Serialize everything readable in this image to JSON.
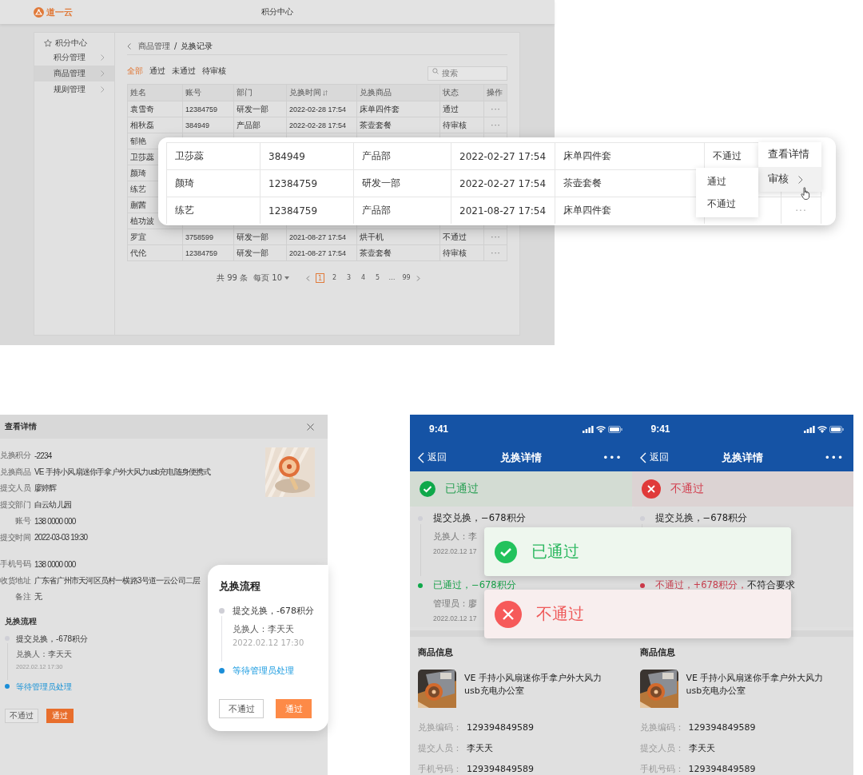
{
  "admin": {
    "logo": "道一云",
    "title": "积分中心",
    "sidebar": {
      "title": "积分中心",
      "items": [
        {
          "label": "积分管理",
          "selected": false
        },
        {
          "label": "商品管理",
          "selected": true
        },
        {
          "label": "规则管理",
          "selected": false
        }
      ]
    },
    "breadcrumb": {
      "parent": "商品管理",
      "separator": "/",
      "current": "兑换记录"
    },
    "filters": [
      {
        "label": "全部",
        "selected": true
      },
      {
        "label": "通过",
        "selected": false
      },
      {
        "label": "未通过",
        "selected": false
      },
      {
        "label": "待审核",
        "selected": false
      }
    ],
    "search": {
      "placeholder": "搜索"
    },
    "table": {
      "columns": [
        {
          "label": "姓名",
          "sortable": false
        },
        {
          "label": "账号",
          "sortable": false
        },
        {
          "label": "部门",
          "sortable": false
        },
        {
          "label": "兑换时间",
          "sortable": true
        },
        {
          "label": "兑换商品",
          "sortable": false
        },
        {
          "label": "状态",
          "sortable": false
        },
        {
          "label": "操作",
          "sortable": false
        }
      ],
      "rows": [
        {
          "cells": [
            "袁雪奇",
            "12384759",
            "研发一部",
            "2022-02-28 17:54",
            "床单四件套",
            "通过"
          ],
          "action": "···"
        },
        {
          "cells": [
            "相秋磊",
            "384949",
            "产品部",
            "2022-02-28 17:54",
            "茶壶套餐",
            "待审核"
          ],
          "action": "···"
        },
        {
          "cells": [
            "郁艳"
          ]
        },
        {
          "cells": [
            "卫莎蕊"
          ]
        },
        {
          "cells": [
            "颜琦"
          ]
        },
        {
          "cells": [
            "练艺"
          ]
        },
        {
          "cells": [
            "蒯茜"
          ]
        },
        {
          "cells": [
            "植功波"
          ]
        },
        {
          "cells": [
            "罗宜",
            "3758599",
            "研发一部",
            "2021-08-27 17:54",
            "烘干机",
            "不通过"
          ],
          "action": "···"
        },
        {
          "cells": [
            "代伦",
            "12384759",
            "研发一部",
            "2021-08-27 17:54",
            "茶壶套餐",
            "待审核"
          ],
          "action": "···"
        }
      ]
    },
    "pagination": {
      "total": "共 99 条",
      "page_size": "每页 10",
      "pages": [
        {
          "label": "1",
          "selected": true
        },
        {
          "label": "2",
          "selected": false
        },
        {
          "label": "3",
          "selected": false
        },
        {
          "label": "4",
          "selected": false
        },
        {
          "label": "5",
          "selected": false
        },
        {
          "label": "…",
          "selected": false
        },
        {
          "label": "99",
          "selected": false
        }
      ]
    }
  },
  "row_menu_zoom": {
    "rows": [
      {
        "cells": [
          "卫莎蕊",
          "384949",
          "产品部",
          "2022-02-27 17:54",
          "床单四件套",
          "不通过"
        ]
      },
      {
        "cells": [
          "颜琦",
          "12384759",
          "研发一部",
          "2022-02-27 17:54",
          "茶壶套餐"
        ]
      },
      {
        "cells": [
          "练艺",
          "12384759",
          "产品部",
          "2021-08-27 17:54",
          "床单四件套"
        ],
        "action": "···"
      }
    ],
    "menu": [
      {
        "label": "查看详情",
        "selected": false,
        "has_submenu": false
      },
      {
        "label": "审核",
        "selected": true,
        "has_submenu": true
      }
    ],
    "submenu": [
      {
        "label": "通过"
      },
      {
        "label": "不通过"
      }
    ]
  },
  "detail_dialog": {
    "title": "查看详情",
    "field_groups": [
      [
        {
          "label": "兑换积分",
          "value": "-2234"
        },
        {
          "label": "兑换商品",
          "value": "VE 手持小风扇迷你手拿户外大风力usb充电随身便携式"
        },
        {
          "label": "提交人员",
          "value": "廖婷辉"
        },
        {
          "label": "提交部门",
          "value": "白云幼儿园"
        },
        {
          "label": "账号",
          "value": "138 0000 000"
        },
        {
          "label": "提交时间",
          "value": "2022-03-03 19:30"
        }
      ],
      [
        {
          "label": "手机号码",
          "value": "138 0000 000"
        },
        {
          "label": "收货地址",
          "value": "广东省广州市天河区员村一横路3号道一云公司二层"
        },
        {
          "label": "备注",
          "value": "无"
        }
      ]
    ],
    "flow_title": "兑换流程",
    "steps": [
      {
        "kind": "done",
        "title": "提交兑换，-678积分",
        "person": "兑换人：李天天",
        "time": "2022.02.12 17:30"
      },
      {
        "kind": "pending",
        "title": "等待管理员处理"
      }
    ],
    "reject_button": "不通过",
    "approve_button": "通过"
  },
  "flow_card": {
    "title": "兑换流程",
    "steps": [
      {
        "kind": "done",
        "title": "提交兑换，-678积分",
        "person": "兑换人：李天天",
        "time": "2022.02.12 17:30"
      },
      {
        "kind": "pending",
        "title": "等待管理员处理"
      }
    ],
    "reject_button": "不通过",
    "approve_button": "通过"
  },
  "phones": [
    {
      "time": "9:41",
      "back": "返回",
      "title": "兑换详情",
      "more": "•••",
      "status": {
        "kind": "approved",
        "label": "已通过"
      },
      "steps": [
        {
          "kind": "done",
          "title": "提交兑换，−678积分",
          "person": "兑换人：李",
          "time": "2022.02.12 17"
        },
        {
          "kind": "approved",
          "title": "已通过，−678积分",
          "person": "管理员：廖",
          "time": "2022.02.12 17"
        }
      ],
      "product_section": "商品信息",
      "product_name": "VE 手持小风扇迷你手拿户外大风力usb充电办公室",
      "fields": [
        {
          "label": "兑换编码：",
          "value": "129394849589"
        },
        {
          "label": "提交人员：",
          "value": "李天天"
        },
        {
          "label": "手机号码：",
          "value": "129394849589"
        }
      ]
    },
    {
      "time": "9:41",
      "back": "返回",
      "title": "兑换详情",
      "more": "•••",
      "status": {
        "kind": "rejected",
        "label": "不通过"
      },
      "steps": [
        {
          "kind": "done",
          "title": "提交兑换，−678积分"
        },
        {
          "kind": "rejected",
          "title": "不通过，+678积分，",
          "note": "不符合要求"
        }
      ],
      "product_section": "商品信息",
      "product_name": "VE 手持小风扇迷你手拿户外大风力usb充电办公室",
      "fields": [
        {
          "label": "兑换编码：",
          "value": "129394849589"
        },
        {
          "label": "提交人员：",
          "value": "李天天"
        },
        {
          "label": "手机号码：",
          "value": "129394849589"
        }
      ]
    }
  ],
  "toasts": [
    {
      "kind": "approved",
      "label": "已通过"
    },
    {
      "kind": "rejected",
      "label": "不通过"
    }
  ]
}
